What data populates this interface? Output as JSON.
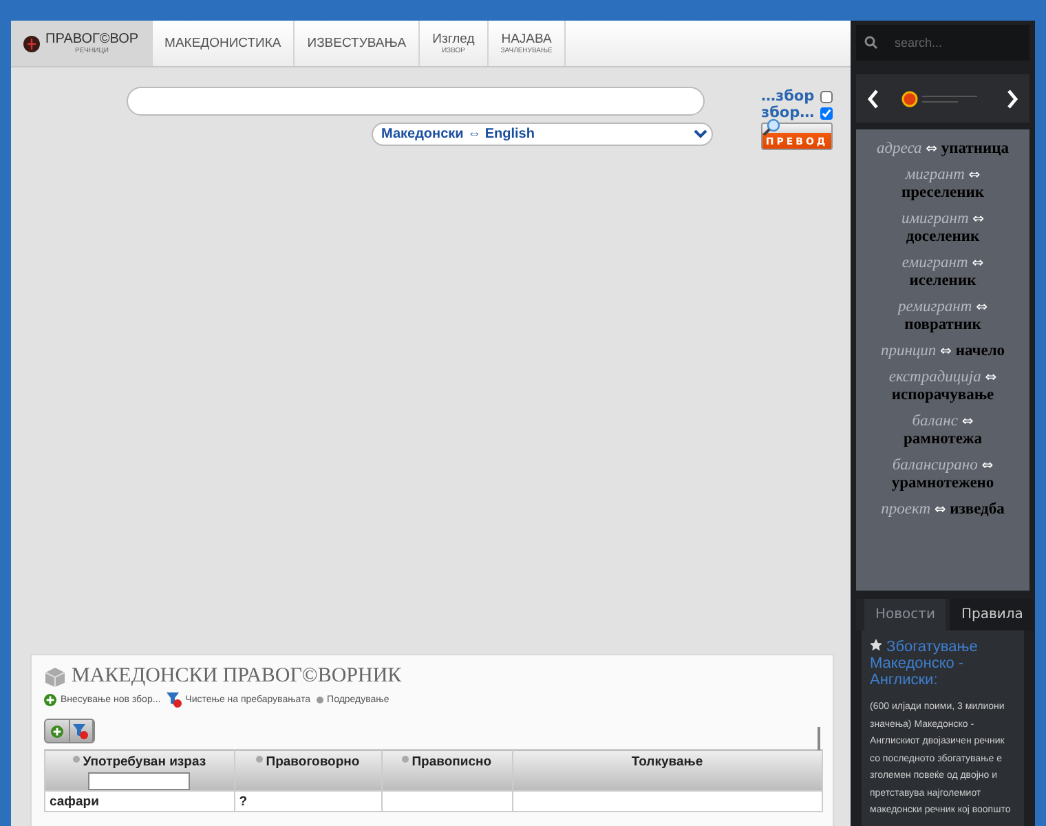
{
  "nav": {
    "items": [
      {
        "kind": "logo",
        "label": "ПРАВОГ©ВОР",
        "sub": "РЕЧНИЦИ",
        "selected": true
      },
      {
        "kind": "plain",
        "label": "МАКЕДОНИСТИКА",
        "selected": false
      },
      {
        "kind": "plain",
        "label": "ИЗВЕСТУВАЊА",
        "selected": false
      },
      {
        "kind": "sub",
        "label": "Изглед",
        "sub": "ИЗВОР",
        "selected": false
      },
      {
        "kind": "sub",
        "label": "НАЈАВА",
        "sub": "ЗАЧЛЕНУВАЊЕ",
        "selected": false
      }
    ]
  },
  "search": {
    "language": "Македонски ⇔ English",
    "options": [
      {
        "label": "…збор",
        "checked": false
      },
      {
        "label": "збор…",
        "checked": true
      }
    ],
    "button": "ПРЕВОД"
  },
  "dictionary": {
    "title": "МАКЕДОНСКИ ПРАВОГ©ВОРНИК",
    "actions": [
      {
        "kind": "add",
        "label": "Внесување нов збор..."
      },
      {
        "kind": "clear",
        "label": "Чистење на пребарувањата"
      },
      {
        "kind": "sort",
        "label": "Подредување"
      }
    ],
    "table": {
      "columns": [
        {
          "label": "Употребуван израз",
          "filter": true,
          "sortable": true
        },
        {
          "label": "Правоговорно",
          "filter": false,
          "sortable": true
        },
        {
          "label": "Правописно",
          "filter": false,
          "sortable": true
        },
        {
          "label": "Толкување",
          "filter": false,
          "sortable": false
        }
      ],
      "rows": [
        [
          "сафари",
          "?",
          "",
          ""
        ]
      ]
    }
  },
  "sidebar": {
    "search_placeholder": "search...",
    "pairs": [
      {
        "term": "адреса",
        "arrow": "⇔",
        "translation": "упатница"
      },
      {
        "term": "мигрант",
        "arrow": "⇔",
        "translation": "преселеник"
      },
      {
        "term": "имигрант",
        "arrow": "⇔",
        "translation": "доселеник"
      },
      {
        "term": "емигрант",
        "arrow": "⇔",
        "translation": "иселеник"
      },
      {
        "term": "ремигрант",
        "arrow": "⇔",
        "translation": "повратник"
      },
      {
        "term": "принцип",
        "arrow": "⇔",
        "translation": "начело"
      },
      {
        "term": "екстрадиција",
        "arrow": "⇔",
        "translation": "испорачување"
      },
      {
        "term": "баланс",
        "arrow": "⇔",
        "translation": "рамнотежа"
      },
      {
        "term": "балансирано",
        "arrow": "⇔",
        "translation": "урамнотежено"
      },
      {
        "term": "проект",
        "arrow": "⇔",
        "translation": "изведба"
      }
    ],
    "tabs": [
      {
        "label": "Новости",
        "selected": true
      },
      {
        "label": "Правила",
        "selected": false
      }
    ],
    "news": {
      "title": "Збогатување Македонско - Англиски:",
      "body": "(600 илјади поими, 3 милиони значења) Македонско - Англискиот двојазичен речник со последното збогатување е зголемен повеќе од двојно и претставува најголемиот македонски речник кој воопшто"
    }
  }
}
